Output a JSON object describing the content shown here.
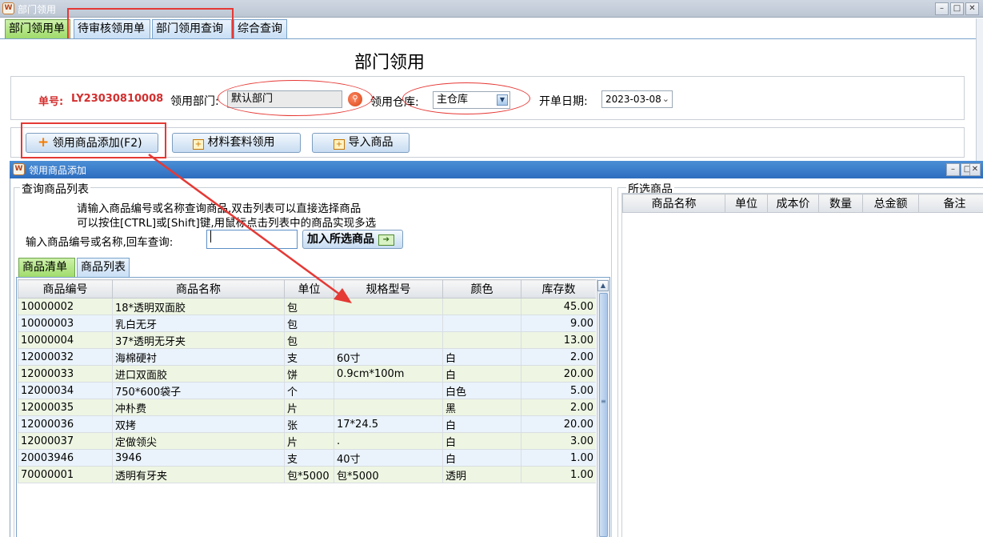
{
  "window": {
    "title": "部门领用"
  },
  "tabs": [
    {
      "label": "部门领用单"
    },
    {
      "label": "待审核领用单"
    },
    {
      "label": "部门领用查询"
    },
    {
      "label": "综合查询"
    }
  ],
  "form": {
    "heading": "部门领用",
    "order_label": "单号:",
    "order_no": "LY23030810008",
    "dept_label": "领用部门:",
    "dept_value": "默认部门",
    "warehouse_label": "领用仓库:",
    "warehouse_value": "主仓库",
    "date_label": "开单日期:",
    "date_value": "2023-03-08"
  },
  "toolbar": {
    "add_goods": "领用商品添加(F2)",
    "material_kit": "材料套料领用",
    "import_goods": "导入商品"
  },
  "dialog": {
    "title": "领用商品添加",
    "group_label": "查询商品列表",
    "hint_line1": "请输入商品编号或名称查询商品,双击列表可以直接选择商品",
    "hint_line2": "可以按住[CTRL]或[Shift]键,用鼠标点击列表中的商品实现多选",
    "search_label": "输入商品编号或名称,回车查询:",
    "search_value": "",
    "add_selected": "加入所选商品",
    "subtabs": [
      {
        "label": "商品清单"
      },
      {
        "label": "商品列表"
      }
    ],
    "columns": [
      "商品编号",
      "商品名称",
      "单位",
      "规格型号",
      "颜色",
      "库存数"
    ],
    "rows": [
      [
        "10000002",
        "18*透明双面胶",
        "包",
        "",
        "",
        "45.00"
      ],
      [
        "10000003",
        "乳白无牙",
        "包",
        "",
        "",
        "9.00"
      ],
      [
        "10000004",
        "37*透明无牙夹",
        "包",
        "",
        "",
        "13.00"
      ],
      [
        "12000032",
        "海棉硬衬",
        "支",
        "60寸",
        "白",
        "2.00"
      ],
      [
        "12000033",
        "进口双面胶",
        "饼",
        "0.9cm*100m",
        "白",
        "20.00"
      ],
      [
        "12000034",
        "750*600袋子",
        "个",
        "",
        "白色",
        "5.00"
      ],
      [
        "12000035",
        "冲朴费",
        "片",
        "",
        "黑",
        "2.00"
      ],
      [
        "12000036",
        "双拷",
        "张",
        "17*24.5",
        "白",
        "20.00"
      ],
      [
        "12000037",
        "定做领尖",
        "片",
        ".",
        "白",
        "3.00"
      ],
      [
        "20003946",
        "3946",
        "支",
        "40寸",
        "白",
        "1.00"
      ],
      [
        "70000001",
        "透明有牙夹",
        "包*5000",
        "包*5000",
        "透明",
        "1.00"
      ]
    ],
    "selected_group_label": "所选商品",
    "selected_columns": [
      "商品名称",
      "单位",
      "成本价",
      "数量",
      "总金额",
      "备注"
    ]
  },
  "colors": {
    "highlight": "#e53935",
    "order_no": "#d32f2f",
    "dialog_title": "#2d6dbf"
  }
}
